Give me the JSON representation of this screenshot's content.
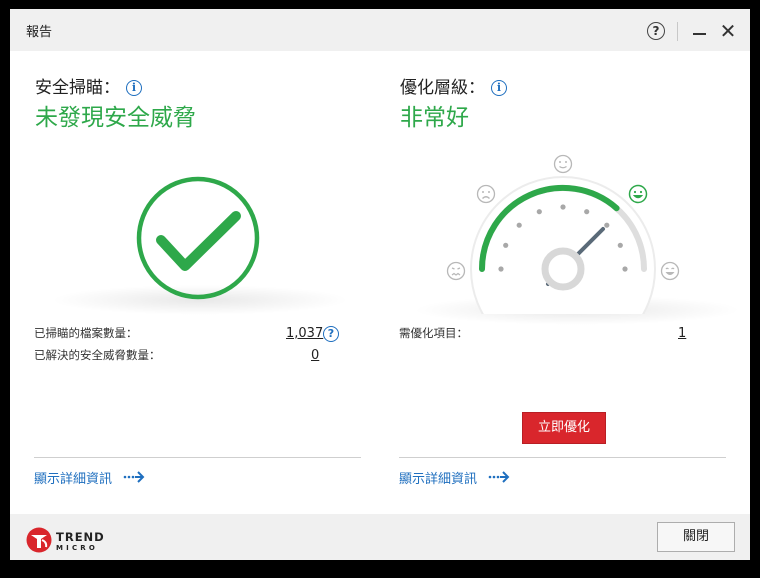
{
  "window": {
    "title": "報告",
    "help_glyph": "?",
    "close_glyph": "✕"
  },
  "security_scan": {
    "label": "安全掃瞄：",
    "info_glyph": "i",
    "status": "未發現安全威脅",
    "files_scanned_label": "已掃瞄的檔案數量：",
    "files_scanned_value": "1,037",
    "help_glyph": "?",
    "threats_resolved_label": "已解決的安全威脅數量：",
    "threats_resolved_value": "0",
    "more_link": "顯示詳細資訊",
    "accent_color": "#2ea84a"
  },
  "optimization": {
    "label": "優化層級：",
    "info_glyph": "i",
    "status": "非常好",
    "gauge_level": 4,
    "gauge_levels": 5,
    "items_label": "需優化項目：",
    "items_value": "1",
    "optimize_button": "立即優化",
    "more_link": "顯示詳細資訊",
    "button_color": "#d9262c"
  },
  "footer": {
    "brand_line1": "TREND",
    "brand_line2": "MICRO",
    "close_button": "關閉"
  }
}
